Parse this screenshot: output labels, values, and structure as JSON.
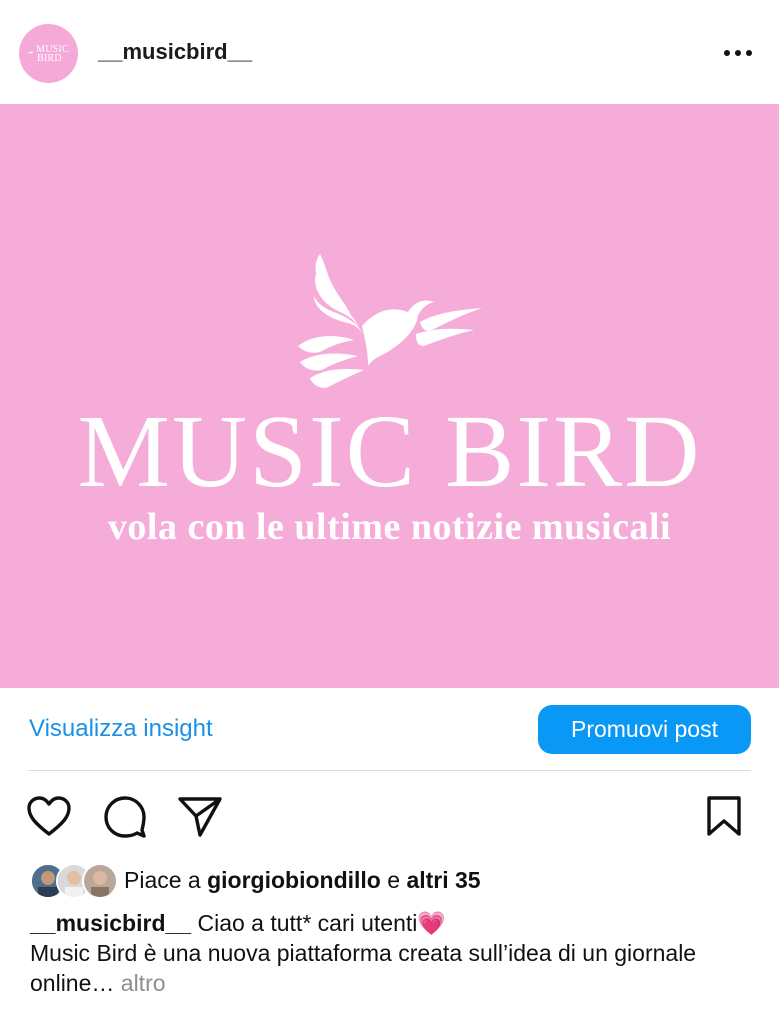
{
  "header": {
    "username": "__musicbird__",
    "avatar_text_line1": "MUSIC",
    "avatar_text_line2": "BIRD",
    "more_icon": "more-horizontal-icon"
  },
  "post": {
    "title": "MUSIC BIRD",
    "tagline": "vola con le ultime notizie musicali",
    "background_color": "#f6acd8",
    "logo_icon": "bird-wings-icon"
  },
  "insight": {
    "link_label": "Visualizza insight",
    "promote_label": "Promuovi post",
    "accent_color": "#0a98f7"
  },
  "actions": {
    "like_icon": "heart-icon",
    "comment_icon": "comment-icon",
    "share_icon": "send-icon",
    "save_icon": "bookmark-icon"
  },
  "likes": {
    "prefix": "Piace a",
    "user": "giorgiobiondillo",
    "conjunction": "e",
    "others": "altri 35"
  },
  "caption": {
    "username": "__musicbird__",
    "line1": "Ciao a tutt* cari utenti",
    "emoji": "💗",
    "body": "Music Bird è una nuova piattaforma creata sull’idea di un giornale online…",
    "more_label": "altro"
  }
}
